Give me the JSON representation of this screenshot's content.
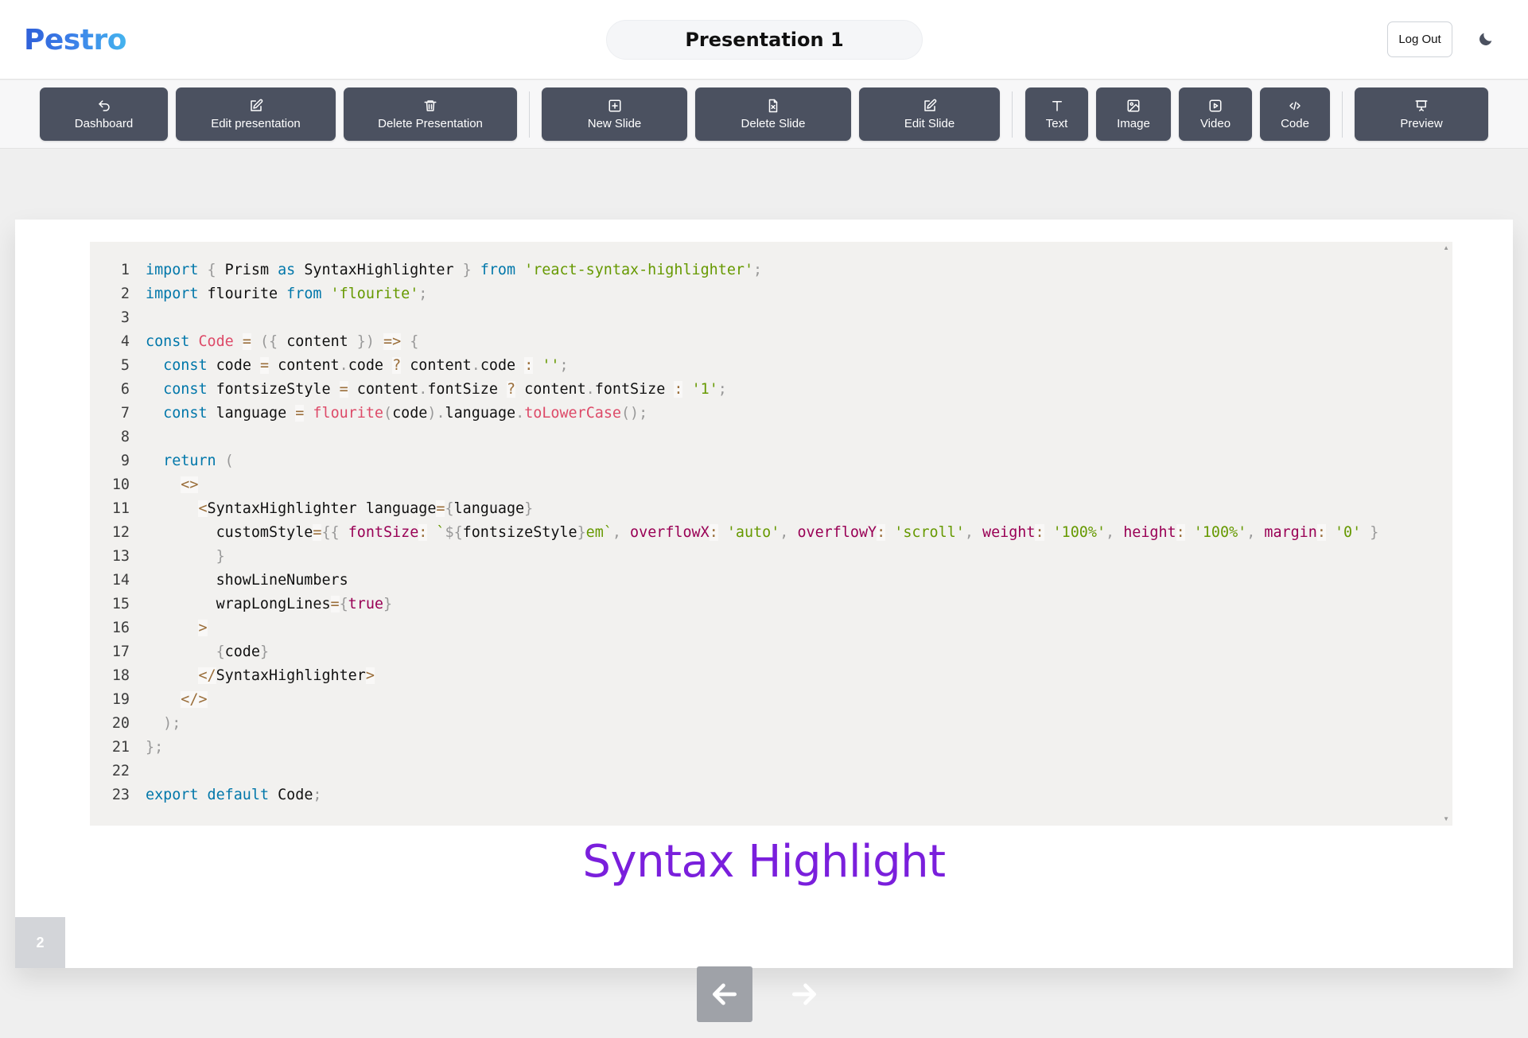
{
  "app": {
    "logo": "Pestro",
    "title": "Presentation 1"
  },
  "header": {
    "logout_label": "Log Out",
    "theme_icon": "moon-icon"
  },
  "toolbar": {
    "dashboard": "Dashboard",
    "edit_presentation": "Edit presentation",
    "delete_presentation": "Delete Presentation",
    "new_slide": "New Slide",
    "delete_slide": "Delete Slide",
    "edit_slide": "Edit Slide",
    "text": "Text",
    "image": "Image",
    "video": "Video",
    "code": "Code",
    "preview": "Preview"
  },
  "slide": {
    "number": "2",
    "caption": "Syntax Highlight",
    "code_lines": [
      [
        [
          "k",
          "import"
        ],
        [
          "p",
          " { "
        ],
        [
          "t",
          "Prism "
        ],
        [
          "k",
          "as"
        ],
        [
          "t",
          " SyntaxHighlighter "
        ],
        [
          "p",
          "} "
        ],
        [
          "k",
          "from"
        ],
        [
          "t",
          " "
        ],
        [
          "s",
          "'react-syntax-highlighter'"
        ],
        [
          "p",
          ";"
        ]
      ],
      [
        [
          "k",
          "import"
        ],
        [
          "t",
          " flourite "
        ],
        [
          "k",
          "from"
        ],
        [
          "t",
          " "
        ],
        [
          "s",
          "'flourite'"
        ],
        [
          "p",
          ";"
        ]
      ],
      [],
      [
        [
          "k",
          "const"
        ],
        [
          "t",
          " "
        ],
        [
          "f",
          "Code"
        ],
        [
          "t",
          " "
        ],
        [
          "o",
          "="
        ],
        [
          "t",
          " "
        ],
        [
          "p",
          "({"
        ],
        [
          "t",
          " content "
        ],
        [
          "p",
          "})"
        ],
        [
          "t",
          " "
        ],
        [
          "o",
          "=>"
        ],
        [
          "t",
          " "
        ],
        [
          "p",
          "{"
        ]
      ],
      [
        [
          "t",
          "  "
        ],
        [
          "k",
          "const"
        ],
        [
          "t",
          " code "
        ],
        [
          "o",
          "="
        ],
        [
          "t",
          " content"
        ],
        [
          "p",
          "."
        ],
        [
          "t",
          "code "
        ],
        [
          "o",
          "?"
        ],
        [
          "t",
          " content"
        ],
        [
          "p",
          "."
        ],
        [
          "t",
          "code "
        ],
        [
          "o",
          ":"
        ],
        [
          "t",
          " "
        ],
        [
          "s",
          "''"
        ],
        [
          "p",
          ";"
        ]
      ],
      [
        [
          "t",
          "  "
        ],
        [
          "k",
          "const"
        ],
        [
          "t",
          " fontsizeStyle "
        ],
        [
          "o",
          "="
        ],
        [
          "t",
          " content"
        ],
        [
          "p",
          "."
        ],
        [
          "t",
          "fontSize "
        ],
        [
          "o",
          "?"
        ],
        [
          "t",
          " content"
        ],
        [
          "p",
          "."
        ],
        [
          "t",
          "fontSize "
        ],
        [
          "o",
          ":"
        ],
        [
          "t",
          " "
        ],
        [
          "s",
          "'1'"
        ],
        [
          "p",
          ";"
        ]
      ],
      [
        [
          "t",
          "  "
        ],
        [
          "k",
          "const"
        ],
        [
          "t",
          " language "
        ],
        [
          "o",
          "="
        ],
        [
          "t",
          " "
        ],
        [
          "f",
          "flourite"
        ],
        [
          "p",
          "("
        ],
        [
          "t",
          "code"
        ],
        [
          "p",
          ")."
        ],
        [
          "t",
          "language"
        ],
        [
          "p",
          "."
        ],
        [
          "f",
          "toLowerCase"
        ],
        [
          "p",
          "();"
        ]
      ],
      [],
      [
        [
          "t",
          "  "
        ],
        [
          "k",
          "return"
        ],
        [
          "t",
          " "
        ],
        [
          "p",
          "("
        ]
      ],
      [
        [
          "t",
          "    "
        ],
        [
          "o",
          "<>"
        ]
      ],
      [
        [
          "t",
          "      "
        ],
        [
          "o",
          "<"
        ],
        [
          "t",
          "SyntaxHighlighter language"
        ],
        [
          "o",
          "="
        ],
        [
          "p",
          "{"
        ],
        [
          "t",
          "language"
        ],
        [
          "p",
          "}"
        ]
      ],
      [
        [
          "t",
          "        customStyle"
        ],
        [
          "o",
          "="
        ],
        [
          "p",
          "{{"
        ],
        [
          "t",
          " "
        ],
        [
          "pr",
          "fontSize"
        ],
        [
          "o",
          ":"
        ],
        [
          "t",
          " "
        ],
        [
          "s",
          "`"
        ],
        [
          "p",
          "${"
        ],
        [
          "t",
          "fontsizeStyle"
        ],
        [
          "p",
          "}"
        ],
        [
          "s",
          "em`"
        ],
        [
          "p",
          ","
        ],
        [
          "t",
          " "
        ],
        [
          "pr",
          "overflowX"
        ],
        [
          "o",
          ":"
        ],
        [
          "t",
          " "
        ],
        [
          "s",
          "'auto'"
        ],
        [
          "p",
          ","
        ],
        [
          "t",
          " "
        ],
        [
          "pr",
          "overflowY"
        ],
        [
          "o",
          ":"
        ],
        [
          "t",
          " "
        ],
        [
          "s",
          "'scroll'"
        ],
        [
          "p",
          ","
        ],
        [
          "t",
          " "
        ],
        [
          "pr",
          "weight"
        ],
        [
          "o",
          ":"
        ],
        [
          "t",
          " "
        ],
        [
          "s",
          "'100%'"
        ],
        [
          "p",
          ","
        ],
        [
          "t",
          " "
        ],
        [
          "pr",
          "height"
        ],
        [
          "o",
          ":"
        ],
        [
          "t",
          " "
        ],
        [
          "s",
          "'100%'"
        ],
        [
          "p",
          ","
        ],
        [
          "t",
          " "
        ],
        [
          "pr",
          "margin"
        ],
        [
          "o",
          ":"
        ],
        [
          "t",
          " "
        ],
        [
          "s",
          "'0'"
        ],
        [
          "t",
          " "
        ],
        [
          "p",
          "}"
        ]
      ],
      [
        [
          "t",
          "        "
        ],
        [
          "p",
          "}"
        ]
      ],
      [
        [
          "t",
          "        showLineNumbers"
        ]
      ],
      [
        [
          "t",
          "        wrapLongLines"
        ],
        [
          "o",
          "="
        ],
        [
          "p",
          "{"
        ],
        [
          "b",
          "true"
        ],
        [
          "p",
          "}"
        ]
      ],
      [
        [
          "t",
          "      "
        ],
        [
          "o",
          ">"
        ]
      ],
      [
        [
          "t",
          "        "
        ],
        [
          "p",
          "{"
        ],
        [
          "t",
          "code"
        ],
        [
          "p",
          "}"
        ]
      ],
      [
        [
          "t",
          "      "
        ],
        [
          "o",
          "</"
        ],
        [
          "t",
          "SyntaxHighlighter"
        ],
        [
          "o",
          ">"
        ]
      ],
      [
        [
          "t",
          "    "
        ],
        [
          "o",
          "</>"
        ]
      ],
      [
        [
          "t",
          "  "
        ],
        [
          "p",
          ");"
        ]
      ],
      [
        [
          "p",
          "};"
        ]
      ],
      [],
      [
        [
          "k",
          "export"
        ],
        [
          "t",
          " "
        ],
        [
          "k",
          "default"
        ],
        [
          "t",
          " Code"
        ],
        [
          "p",
          ";"
        ]
      ]
    ]
  },
  "nav": {
    "prev_icon": "arrow-left-icon",
    "next_icon": "arrow-right-icon"
  }
}
